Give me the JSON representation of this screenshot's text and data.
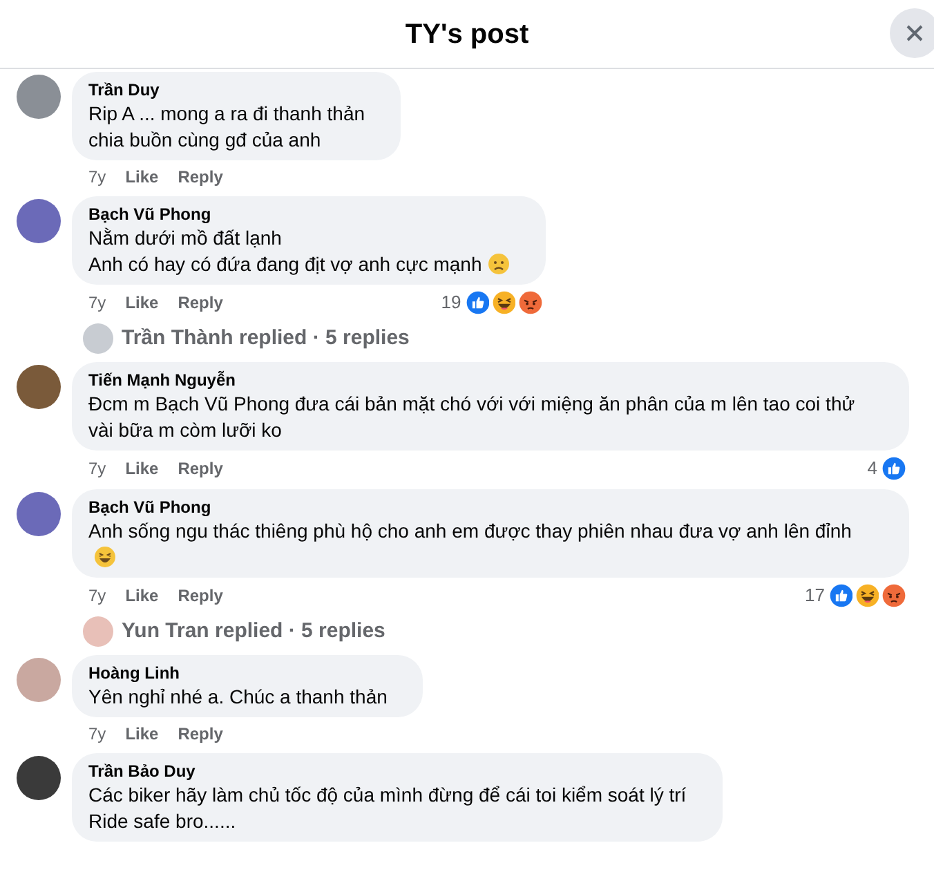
{
  "header": {
    "title": "TY's post"
  },
  "items": [
    {
      "kind": "comment",
      "author": "Trần Duy",
      "lines": [
        "Rip A ... mong a ra đi thanh thản",
        "chia buồn cùng gđ của anh"
      ],
      "time": "7y",
      "like": "Like",
      "reply": "Reply"
    },
    {
      "kind": "comment",
      "author": "Bạch Vũ Phong",
      "lines": [
        "Nằm dưới mồ đất lạnh",
        "Anh có hay có đứa đang địt vợ anh cực mạnh"
      ],
      "emoji": {
        "kind": "worried"
      },
      "time": "7y",
      "like": "Like",
      "reply": "Reply",
      "reaction_count": "19",
      "reactions": [
        {
          "kind": "like"
        },
        {
          "kind": "haha"
        },
        {
          "kind": "angry"
        }
      ]
    },
    {
      "kind": "replies",
      "text": "Trần Thành replied · 5 replies"
    },
    {
      "kind": "comment",
      "author": "Tiến Mạnh Nguyễn",
      "lines": [
        "Đcm m Bạch Vũ Phong đưa cái bản mặt chó với với miệng ăn phân của m lên tao coi thử vài bữa m còm lưỡi ko"
      ],
      "time": "7y",
      "like": "Like",
      "reply": "Reply",
      "reaction_count": "4",
      "reactions": [
        {
          "kind": "like"
        }
      ]
    },
    {
      "kind": "comment",
      "author": "Bạch Vũ Phong",
      "lines": [
        "Anh sống ngu thác thiêng phù hộ cho anh em được thay phiên nhau đưa vợ anh lên đỉnh"
      ],
      "emoji": {
        "kind": "laugh"
      },
      "time": "7y",
      "like": "Like",
      "reply": "Reply",
      "reaction_count": "17",
      "reactions": [
        {
          "kind": "like"
        },
        {
          "kind": "haha"
        },
        {
          "kind": "angry"
        }
      ]
    },
    {
      "kind": "replies",
      "text": "Yun Tran replied · 5 replies"
    },
    {
      "kind": "comment",
      "author": "Hoàng Linh",
      "lines": [
        "Yên nghỉ nhé a. Chúc a thanh thản"
      ],
      "time": "7y",
      "like": "Like",
      "reply": "Reply"
    },
    {
      "kind": "comment",
      "author": "Trần Bảo Duy",
      "lines": [
        "Các biker hãy làm chủ tốc độ của mình đừng để cái toi kiểm soát lý trí",
        "Ride safe bro......"
      ]
    }
  ]
}
